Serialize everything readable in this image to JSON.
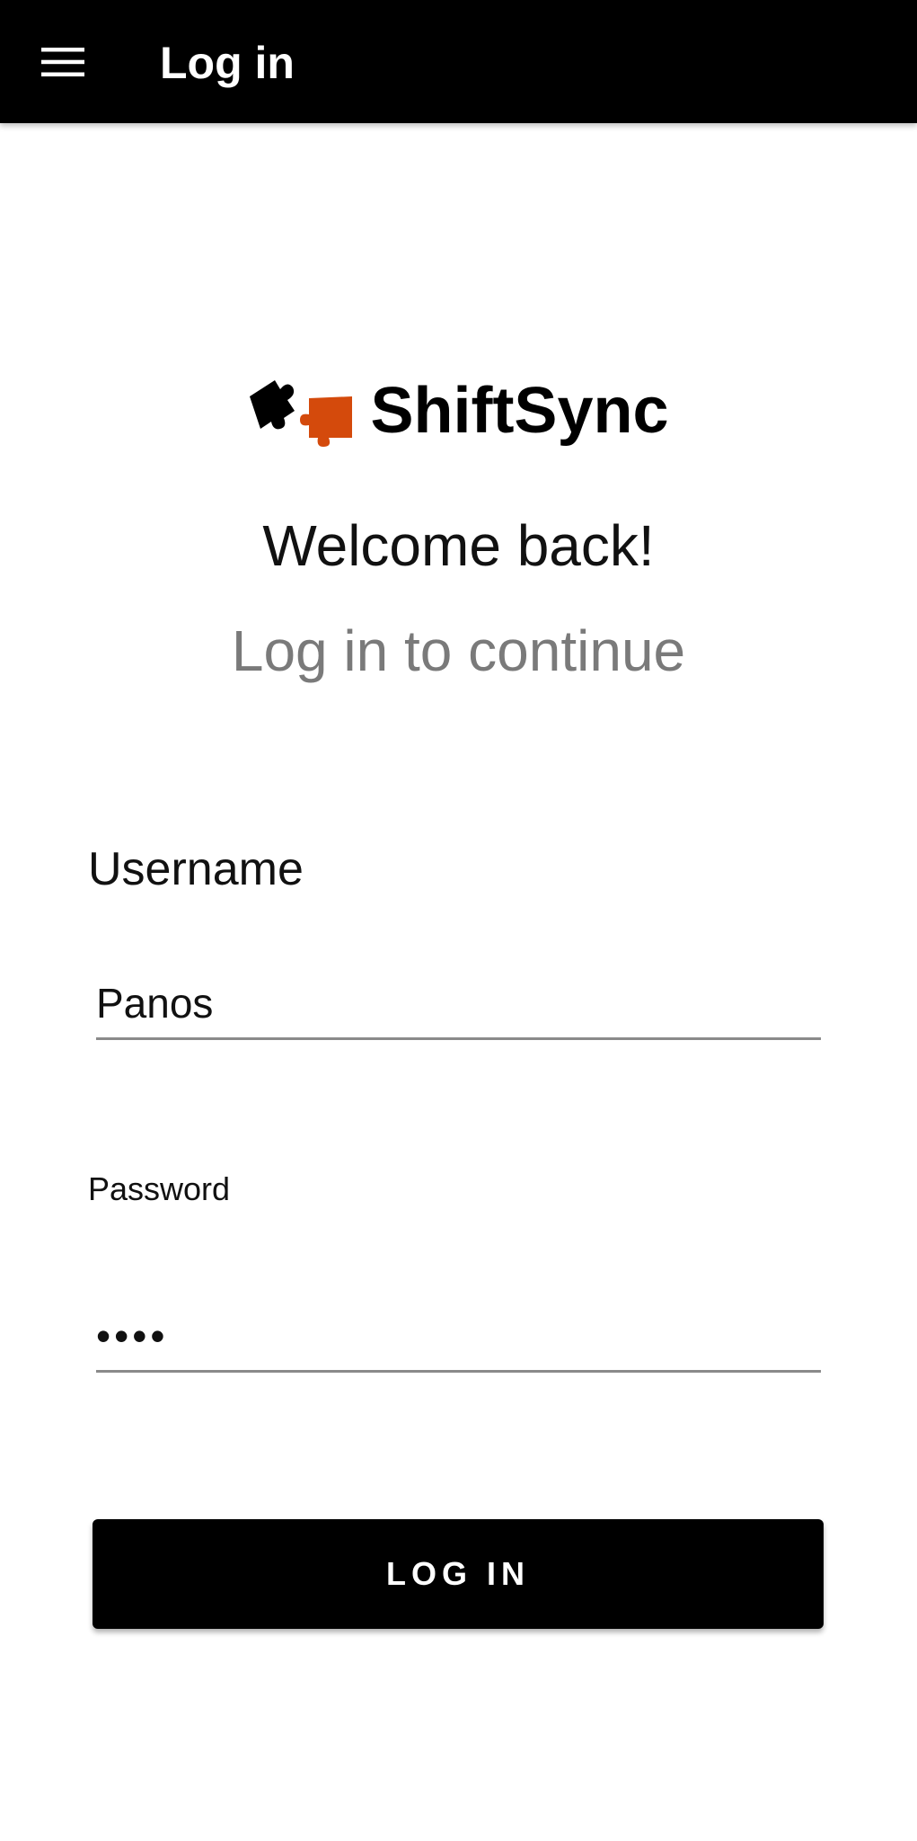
{
  "appbar": {
    "title": "Log in",
    "menu_icon": "hamburger-menu-icon",
    "background": "#000000"
  },
  "brand": {
    "name": "ShiftSync",
    "logo_icon": "puzzle-pieces-icon",
    "accent_color": "#d44a0c"
  },
  "header": {
    "welcome": "Welcome back!",
    "subtitle": "Log in to continue"
  },
  "form": {
    "username_label": "Username",
    "username_value": "Panos",
    "password_label": "Password",
    "password_value": "••••",
    "submit_label": "LOG IN"
  }
}
